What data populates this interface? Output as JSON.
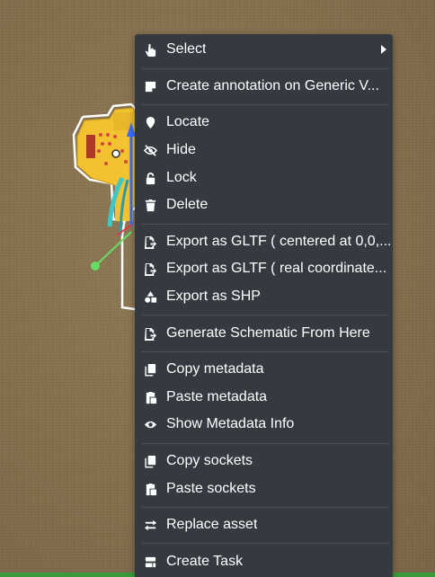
{
  "colors": {
    "menu_background": "#343a40",
    "menu_text": "#ffffff",
    "divider": "#4b525a",
    "ground": "#836e4c",
    "ground_strip": "#3a9a3a",
    "model_yellow": "#f2c230",
    "gizmo_blue": "#3b6cff",
    "gizmo_green": "#66dd66",
    "gizmo_red": "#e03b3b"
  },
  "context_menu": {
    "items": [
      {
        "id": "select",
        "label": "Select",
        "icon": "hand-pointer-icon",
        "submenu": true
      },
      {
        "id": "create-annotation",
        "label": "Create annotation on Generic V...",
        "icon": "annotation-icon"
      },
      {
        "id": "locate",
        "label": "Locate",
        "icon": "map-marker-icon"
      },
      {
        "id": "hide",
        "label": "Hide",
        "icon": "eye-slash-icon"
      },
      {
        "id": "lock",
        "label": "Lock",
        "icon": "lock-icon"
      },
      {
        "id": "delete",
        "label": "Delete",
        "icon": "trash-icon"
      },
      {
        "id": "export-gltf-centered",
        "label": "Export as GLTF ( centered at 0,0,...",
        "icon": "file-export-icon"
      },
      {
        "id": "export-gltf-real",
        "label": "Export as GLTF ( real coordinate...",
        "icon": "file-export-icon"
      },
      {
        "id": "export-shp",
        "label": "Export as SHP",
        "icon": "shapes-icon"
      },
      {
        "id": "generate-schematic",
        "label": "Generate Schematic From Here",
        "icon": "file-export-icon"
      },
      {
        "id": "copy-metadata",
        "label": "Copy metadata",
        "icon": "copy-icon"
      },
      {
        "id": "paste-metadata",
        "label": "Paste metadata",
        "icon": "paste-icon"
      },
      {
        "id": "show-metadata-info",
        "label": "Show Metadata Info",
        "icon": "eye-icon"
      },
      {
        "id": "copy-sockets",
        "label": "Copy sockets",
        "icon": "copy-icon"
      },
      {
        "id": "paste-sockets",
        "label": "Paste sockets",
        "icon": "paste-icon"
      },
      {
        "id": "replace-asset",
        "label": "Replace asset",
        "icon": "exchange-icon"
      },
      {
        "id": "create-task",
        "label": "Create Task",
        "icon": "task-icon"
      }
    ]
  }
}
